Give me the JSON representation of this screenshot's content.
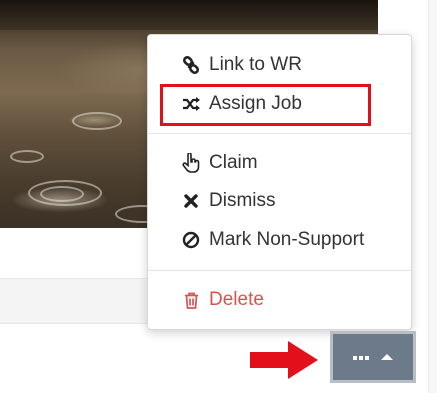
{
  "menu": {
    "items": [
      {
        "label": "Link to WR",
        "icon": "link-icon"
      },
      {
        "label": "Assign Job",
        "icon": "shuffle-icon"
      },
      {
        "label": "Claim",
        "icon": "hand-pointer-icon"
      },
      {
        "label": "Dismiss",
        "icon": "x-icon"
      },
      {
        "label": "Mark Non-Support",
        "icon": "ban-icon"
      },
      {
        "label": "Delete",
        "icon": "trash-icon"
      }
    ]
  },
  "colors": {
    "highlight": "#e3101b",
    "delete": "#d9534f",
    "button_bg": "#6c7a89",
    "arrow": "#e3101b"
  },
  "action_button": {
    "icons": [
      "ellipsis-icon",
      "caret-up-icon"
    ]
  }
}
